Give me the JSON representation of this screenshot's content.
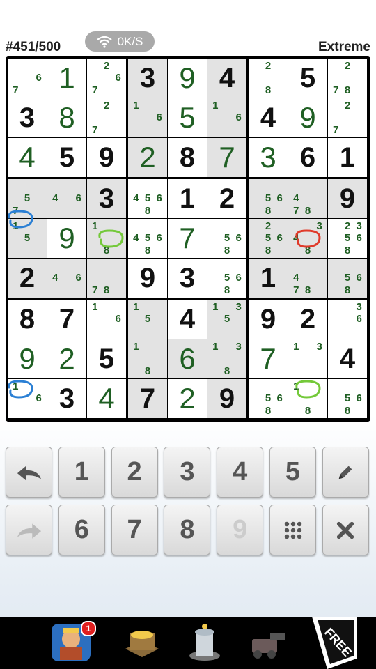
{
  "header": {
    "puzzle": "#451/500",
    "network": "0K/S",
    "difficulty": "Extreme"
  },
  "board": {
    "cells": [
      [
        {
          "n": [
            6,
            7
          ]
        },
        {
          "v": 1,
          "u": true
        },
        {
          "n": [
            2,
            6,
            7
          ]
        },
        {
          "v": 3
        },
        {
          "v": 9,
          "u": true
        },
        {
          "v": 4
        },
        {
          "n": [
            2,
            8
          ]
        },
        {
          "v": 5
        },
        {
          "n": [
            2,
            7,
            8
          ]
        }
      ],
      [
        {
          "v": 3
        },
        {
          "v": 8,
          "u": true
        },
        {
          "n": [
            2,
            7
          ]
        },
        {
          "n": [
            1,
            6
          ]
        },
        {
          "v": 5,
          "u": true
        },
        {
          "n": [
            1,
            6
          ]
        },
        {
          "v": 4
        },
        {
          "v": 9,
          "u": true
        },
        {
          "n": [
            2,
            7
          ]
        }
      ],
      [
        {
          "v": 4,
          "u": true
        },
        {
          "v": 5
        },
        {
          "v": 9
        },
        {
          "v": 2,
          "u": true
        },
        {
          "v": 8
        },
        {
          "v": 7,
          "u": true
        },
        {
          "v": 3,
          "u": true
        },
        {
          "v": 6
        },
        {
          "v": 1
        }
      ],
      [
        {
          "n": [
            5,
            7
          ]
        },
        {
          "n": [
            4,
            6
          ]
        },
        {
          "v": 3
        },
        {
          "n": [
            4,
            5,
            6,
            8
          ]
        },
        {
          "v": 1
        },
        {
          "v": 2
        },
        {
          "n": [
            5,
            6,
            8
          ]
        },
        {
          "n": [
            4,
            7,
            8
          ]
        },
        {
          "v": 9
        }
      ],
      [
        {
          "n": [
            1,
            5
          ]
        },
        {
          "v": 9,
          "u": true
        },
        {
          "n": [
            1,
            8
          ]
        },
        {
          "n": [
            4,
            5,
            6,
            8
          ]
        },
        {
          "v": 7,
          "u": true
        },
        {
          "n": [
            5,
            6,
            8
          ]
        },
        {
          "n": [
            2,
            5,
            6,
            8
          ]
        },
        {
          "n": [
            3,
            4,
            8
          ]
        },
        {
          "n": [
            2,
            3,
            5,
            6,
            8
          ]
        }
      ],
      [
        {
          "v": 2
        },
        {
          "n": [
            4,
            6
          ]
        },
        {
          "n": [
            7,
            8
          ]
        },
        {
          "v": 9
        },
        {
          "v": 3
        },
        {
          "n": [
            5,
            6,
            8
          ]
        },
        {
          "v": 1
        },
        {
          "n": [
            4,
            7,
            8
          ]
        },
        {
          "n": [
            5,
            6,
            8
          ]
        }
      ],
      [
        {
          "v": 8
        },
        {
          "v": 7
        },
        {
          "n": [
            1,
            6
          ]
        },
        {
          "n": [
            1,
            5
          ]
        },
        {
          "v": 4
        },
        {
          "n": [
            1,
            3,
            5
          ]
        },
        {
          "v": 9
        },
        {
          "v": 2
        },
        {
          "n": [
            3,
            6
          ]
        }
      ],
      [
        {
          "v": 9,
          "u": true
        },
        {
          "v": 2,
          "u": true
        },
        {
          "v": 5
        },
        {
          "n": [
            1,
            8
          ]
        },
        {
          "v": 6,
          "u": true
        },
        {
          "n": [
            1,
            3,
            8
          ]
        },
        {
          "v": 7,
          "u": true
        },
        {
          "n": [
            1,
            3
          ]
        },
        {
          "v": 4
        }
      ],
      [
        {
          "n": [
            1,
            6
          ]
        },
        {
          "v": 3
        },
        {
          "v": 4,
          "u": true
        },
        {
          "v": 7
        },
        {
          "v": 2,
          "u": true
        },
        {
          "v": 9
        },
        {
          "n": [
            5,
            6,
            8
          ]
        },
        {
          "n": [
            1,
            8
          ]
        },
        {
          "n": [
            5,
            6,
            8
          ]
        }
      ]
    ],
    "shaded": [
      [
        0,
        3
      ],
      [
        0,
        5
      ],
      [
        1,
        3
      ],
      [
        1,
        5
      ],
      [
        2,
        3
      ],
      [
        2,
        5
      ],
      [
        3,
        0
      ],
      [
        3,
        1
      ],
      [
        3,
        2
      ],
      [
        4,
        0
      ],
      [
        4,
        2
      ],
      [
        5,
        0
      ],
      [
        5,
        1
      ],
      [
        5,
        2
      ],
      [
        3,
        6
      ],
      [
        3,
        7
      ],
      [
        3,
        8
      ],
      [
        4,
        6
      ],
      [
        4,
        7
      ],
      [
        5,
        6
      ],
      [
        5,
        7
      ],
      [
        5,
        8
      ],
      [
        6,
        3
      ],
      [
        6,
        5
      ],
      [
        7,
        3
      ],
      [
        7,
        4
      ],
      [
        7,
        5
      ],
      [
        8,
        3
      ],
      [
        8,
        5
      ]
    ],
    "colors": {
      "given": "#111111",
      "user": "#1f5f23",
      "shade": "#e3e3e3",
      "cell": "#ffffff"
    }
  },
  "marks": [
    {
      "r": 4,
      "c": 0,
      "color": "#2a7fd4"
    },
    {
      "r": 4,
      "c": 2,
      "color": "#74c93a"
    },
    {
      "r": 4,
      "c": 7,
      "color": "#e03a2a"
    },
    {
      "r": 8,
      "c": 0,
      "color": "#2a7fd4"
    },
    {
      "r": 8,
      "c": 7,
      "color": "#74c93a"
    }
  ],
  "keypad": {
    "row1": [
      {
        "icon": "undo-icon"
      },
      {
        "label": "1"
      },
      {
        "label": "2"
      },
      {
        "label": "3"
      },
      {
        "label": "4"
      },
      {
        "label": "5"
      },
      {
        "icon": "pencil-icon"
      }
    ],
    "row2": [
      {
        "icon": "redo-icon",
        "disabled": true
      },
      {
        "label": "6"
      },
      {
        "label": "7"
      },
      {
        "label": "8"
      },
      {
        "label": "9",
        "disabled": true
      },
      {
        "icon": "grid-icon"
      },
      {
        "icon": "clear-icon"
      }
    ]
  },
  "ad": {
    "badge_count": "1",
    "free_label": "FREE"
  }
}
